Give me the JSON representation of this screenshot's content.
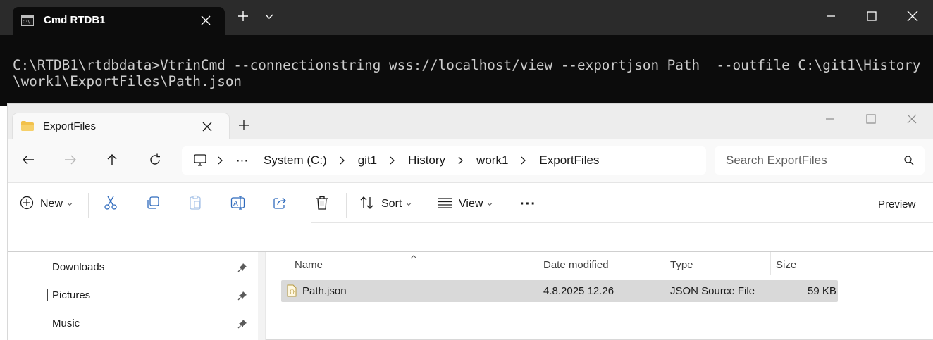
{
  "terminal": {
    "tab_title": "Cmd RTDB1",
    "command_text": "C:\\RTDB1\\rtdbdata>VtrinCmd --connectionstring wss://localhost/view --exportjson Path  --outfile C:\\git1\\History\\work1\\ExportFiles\\Path.json",
    "colors": {
      "background": "#0c0c0c",
      "tabbar": "#2b2b2b",
      "text": "#cccccc"
    },
    "icons": [
      "terminal-icon",
      "close-icon",
      "plus-icon",
      "chevron-down-icon",
      "minimize-icon",
      "maximize-icon",
      "close-icon"
    ]
  },
  "explorer": {
    "tab_title": "ExportFiles",
    "address": {
      "crumbs": [
        "System (C:)",
        "git1",
        "History",
        "work1",
        "ExportFiles"
      ],
      "overflow": "···"
    },
    "search": {
      "placeholder": "Search ExportFiles"
    },
    "toolbar": {
      "new_label": "New",
      "sort_label": "Sort",
      "view_label": "View",
      "more_label": "···",
      "preview_label": "Preview"
    },
    "nav_pane": {
      "items": [
        {
          "label": "Downloads"
        },
        {
          "label": "Pictures"
        },
        {
          "label": "Music"
        }
      ]
    },
    "columns": [
      "Name",
      "Date modified",
      "Type",
      "Size"
    ],
    "files": [
      {
        "name": "Path.json",
        "date_modified": "4.8.2025 12.26",
        "type": "JSON Source File",
        "size": "59 KB"
      }
    ],
    "colors": {
      "titlebar": "#ededed",
      "navbar": "#f9f9f9",
      "selected_row": "#d9d9d9",
      "folder": "#f2c14b"
    }
  }
}
